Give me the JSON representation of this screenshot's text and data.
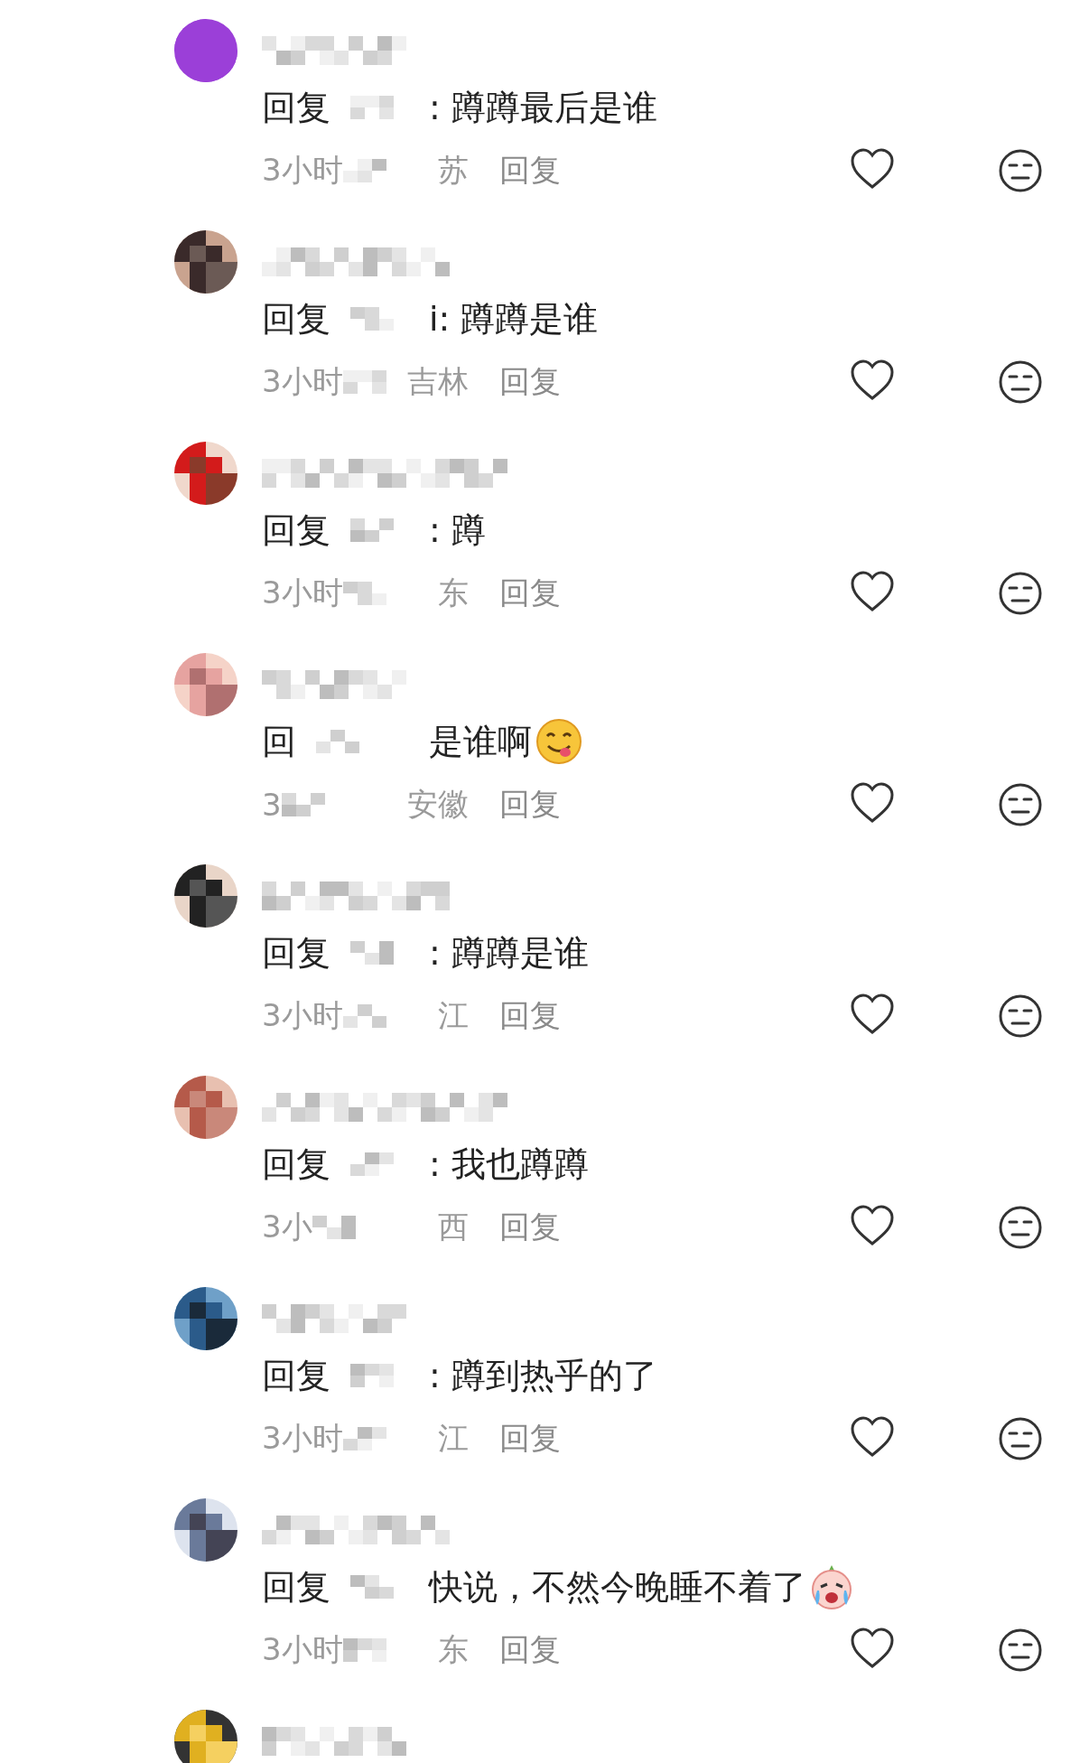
{
  "comments": [
    {
      "kind": "full",
      "reply_label": "回复",
      "reply_text": ": 蹲蹲最后是谁",
      "time": "3小时",
      "region": "苏",
      "reply_button": "回复",
      "liked": false
    },
    {
      "kind": "full",
      "reply_label": "回复",
      "reply_text": "i: 蹲蹲是谁",
      "time": "3小时",
      "region": "吉林",
      "reply_button": "回复",
      "liked": false
    },
    {
      "kind": "full",
      "reply_label": "回复",
      "reply_text": ": 蹲",
      "time": "3小时",
      "region": "东",
      "reply_button": "回复",
      "liked": false
    },
    {
      "kind": "full",
      "reply_label": "回",
      "reply_text": "是谁啊",
      "emoji": {
        "kind": "tongue"
      },
      "time": "3",
      "region": "安徽",
      "reply_button": "回复",
      "liked": false
    },
    {
      "kind": "full",
      "reply_label": "回复",
      "reply_text": ": 蹲蹲是谁",
      "time": "3小时",
      "region": "江",
      "reply_button": "回复",
      "liked": false
    },
    {
      "kind": "full",
      "reply_label": "回复",
      "reply_text": ": 我也蹲蹲",
      "time": "3小",
      "region": "西",
      "reply_button": "回复",
      "liked": false
    },
    {
      "kind": "full",
      "reply_label": "回复",
      "reply_text": ": 蹲到热乎的了",
      "time": "3小时",
      "region": "江",
      "reply_button": "回复",
      "liked": false
    },
    {
      "kind": "full",
      "reply_label": "回复",
      "reply_text": "快说，不然今晚睡不着了",
      "emoji": {
        "kind": "crying"
      },
      "time": "3小时",
      "region": "东",
      "reply_button": "回复",
      "liked": false
    },
    {
      "kind": "cut"
    }
  ]
}
